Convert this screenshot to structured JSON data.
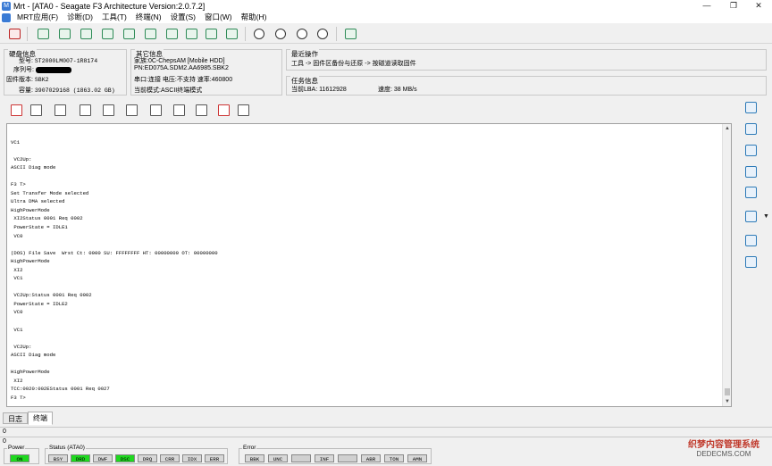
{
  "window": {
    "title": "Mrt - [ATA0 - Seagate F3 Architecture Version:2.0.7.2]",
    "minimize": "—",
    "restore": "❐",
    "close": "✕"
  },
  "menu": [
    "MRT应用(F)",
    "诊断(D)",
    "工具(T)",
    "终端(N)",
    "设置(S)",
    "窗口(W)",
    "帮助(H)"
  ],
  "disk_info": {
    "title": "硬盘信息",
    "model_label": "型号",
    "model_value": "ST2000LM007-1R8174",
    "serial_label": "序列号",
    "firmware_label": "固件版本",
    "firmware_value": "SBK2",
    "capacity_label": "容量",
    "capacity_value": "3907029168 (1863.02 GB)"
  },
  "other_info": {
    "title": "其它信息",
    "family": "家族:0C-ChepsAM [Mobile HDD]",
    "pn": "PN:ED075A.SDM2.AA6985.SBK2",
    "port": "串口:连接  电压:不支持  速率:460800",
    "mode": "当前模式:ASCII终端模式"
  },
  "recent": {
    "title": "最近操作",
    "text": "工具 -> 固件区备份与还原 -> 按磁道读取固件"
  },
  "task": {
    "title": "任务信息",
    "lba": "当前LBA: 11612928",
    "speed": "速度: 38 MB/s"
  },
  "terminal_text": "\nVC1\n\n VC2Up:\nASCII Diag mode\n\nF3 T>\nSet Transfer Mode selected\nUltra DMA selected\nHighPowerMode\n XI2Status 0001 Req 0002\n PowerState = IDLE1\n VC0\n\n(DOS) File Save  Wrst Ct: 0000 SU: FFFFFFFF HT: 00000000 OT: 00000000\nHighPowerMode\n XI2\n VC1\n\n VC2Up:Status 0001 Req 0002\n PowerState = IDLE2\n VC0\n\n VC1\n\n VC2Up:\nASCII Diag mode\n\nHighPowerMode\n XI2\nTCC:0020:002EStatus 0001 Req 0027\nF3 T>",
  "tabs": [
    "日志",
    "终端"
  ],
  "progress": [
    "0",
    "0"
  ],
  "power": {
    "title": "Power",
    "leds": [
      "ON"
    ]
  },
  "status_ata": {
    "title": "Status (ATA0)",
    "leds": [
      "BSY",
      "DRD",
      "DWF",
      "DSC",
      "DRQ",
      "CRR",
      "IDX",
      "ERR"
    ]
  },
  "error": {
    "title": "Error",
    "leds": [
      "BBK",
      "UNC",
      "",
      "INF",
      "",
      "ABR",
      "TON",
      "AMN"
    ]
  },
  "watermark": {
    "line1": "织梦内容管理系统",
    "line2": "DEDECMS.COM"
  }
}
